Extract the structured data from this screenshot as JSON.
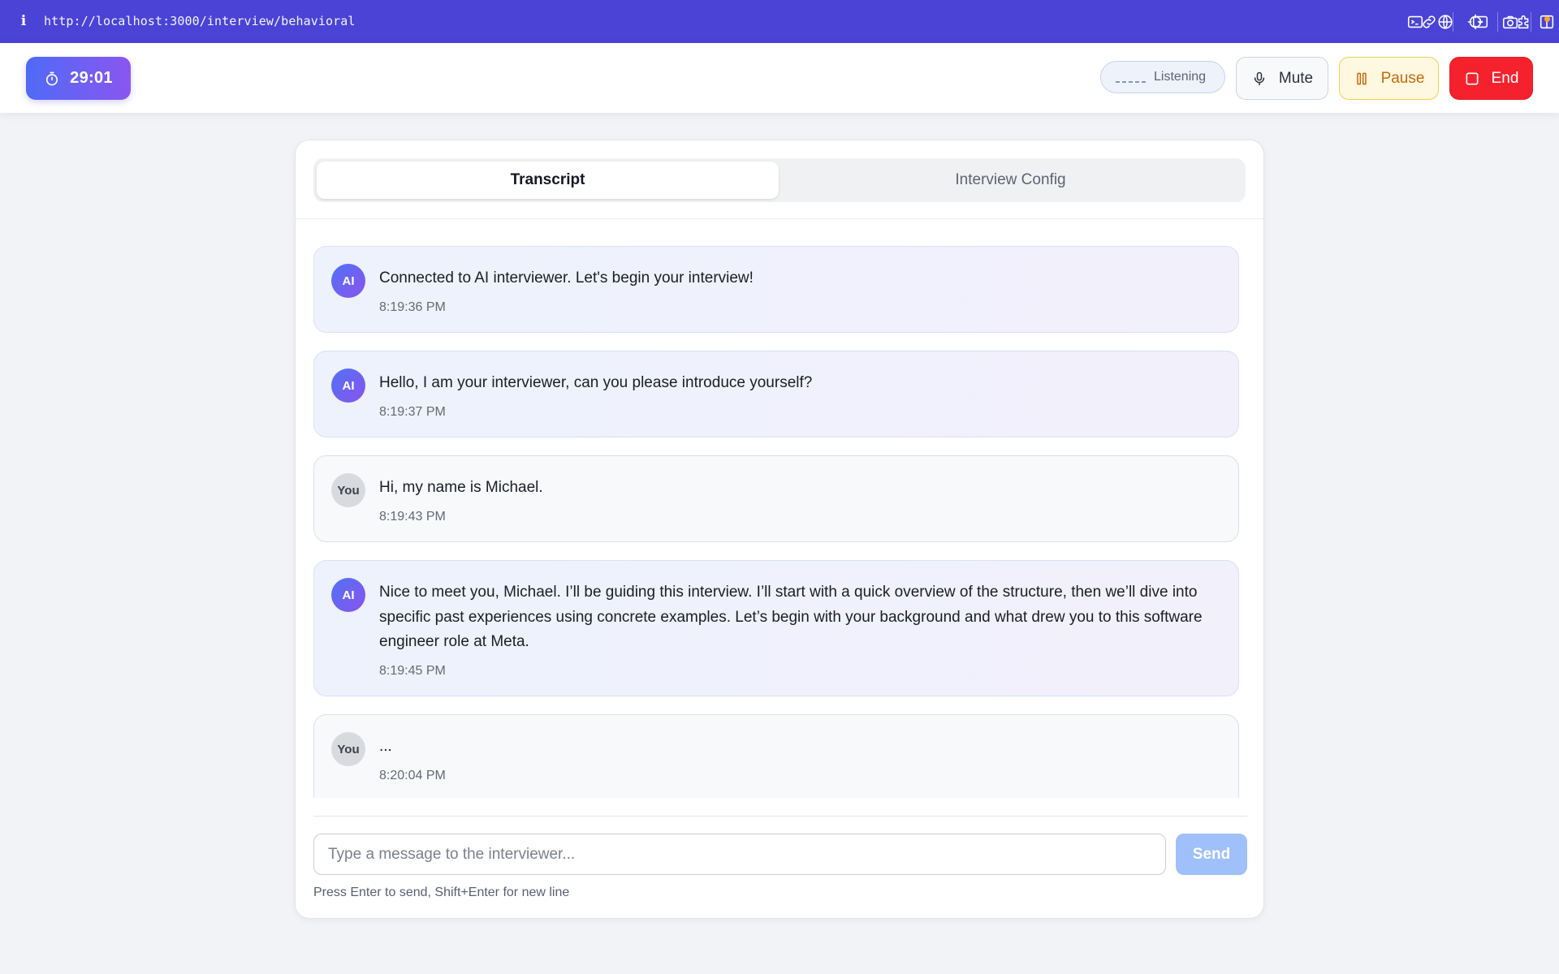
{
  "browser": {
    "url": "http://localhost:3000/interview/behavioral",
    "icons": [
      "info-icon",
      "link-icon",
      "download-icon",
      "camera-icon",
      "terminal-icon",
      "globe-icon",
      "crosshair-icon",
      "extensions-icon",
      "sidebar-icon"
    ]
  },
  "header": {
    "timer": "29:01",
    "status_label": "Listening",
    "mute_label": "Mute",
    "pause_label": "Pause",
    "end_label": "End"
  },
  "tabs": {
    "transcript": "Transcript",
    "config": "Interview Config",
    "active": "Transcript"
  },
  "messages": [
    {
      "sender": "AI",
      "text": "Connected to AI interviewer. Let's begin your interview!",
      "time": "8:19:36 PM"
    },
    {
      "sender": "AI",
      "text": "Hello, I am your interviewer, can you please introduce yourself?",
      "time": "8:19:37 PM"
    },
    {
      "sender": "You",
      "text": "Hi, my name is Michael.",
      "time": "8:19:43 PM"
    },
    {
      "sender": "AI",
      "text": "Nice to meet you, Michael. I’ll be guiding this interview. I’ll start with a quick overview of the structure, then we’ll dive into specific past experiences using concrete examples. Let’s begin with your background and what drew you to this software engineer role at Meta.",
      "time": "8:19:45 PM"
    },
    {
      "sender": "You",
      "text": "...",
      "time": "8:20:04 PM"
    }
  ],
  "composer": {
    "placeholder": "Type a message to the interviewer...",
    "value": "",
    "send_label": "Send",
    "hint": "Press Enter to send, Shift+Enter for new line"
  },
  "colors": {
    "browser_bar": "#4a43d6",
    "timer_gradient_start": "#4f6af7",
    "timer_gradient_end": "#8a56f0",
    "pause_accent": "#f3cf52",
    "end_red": "#f5222d",
    "send_disabled": "#9fc0fb"
  }
}
